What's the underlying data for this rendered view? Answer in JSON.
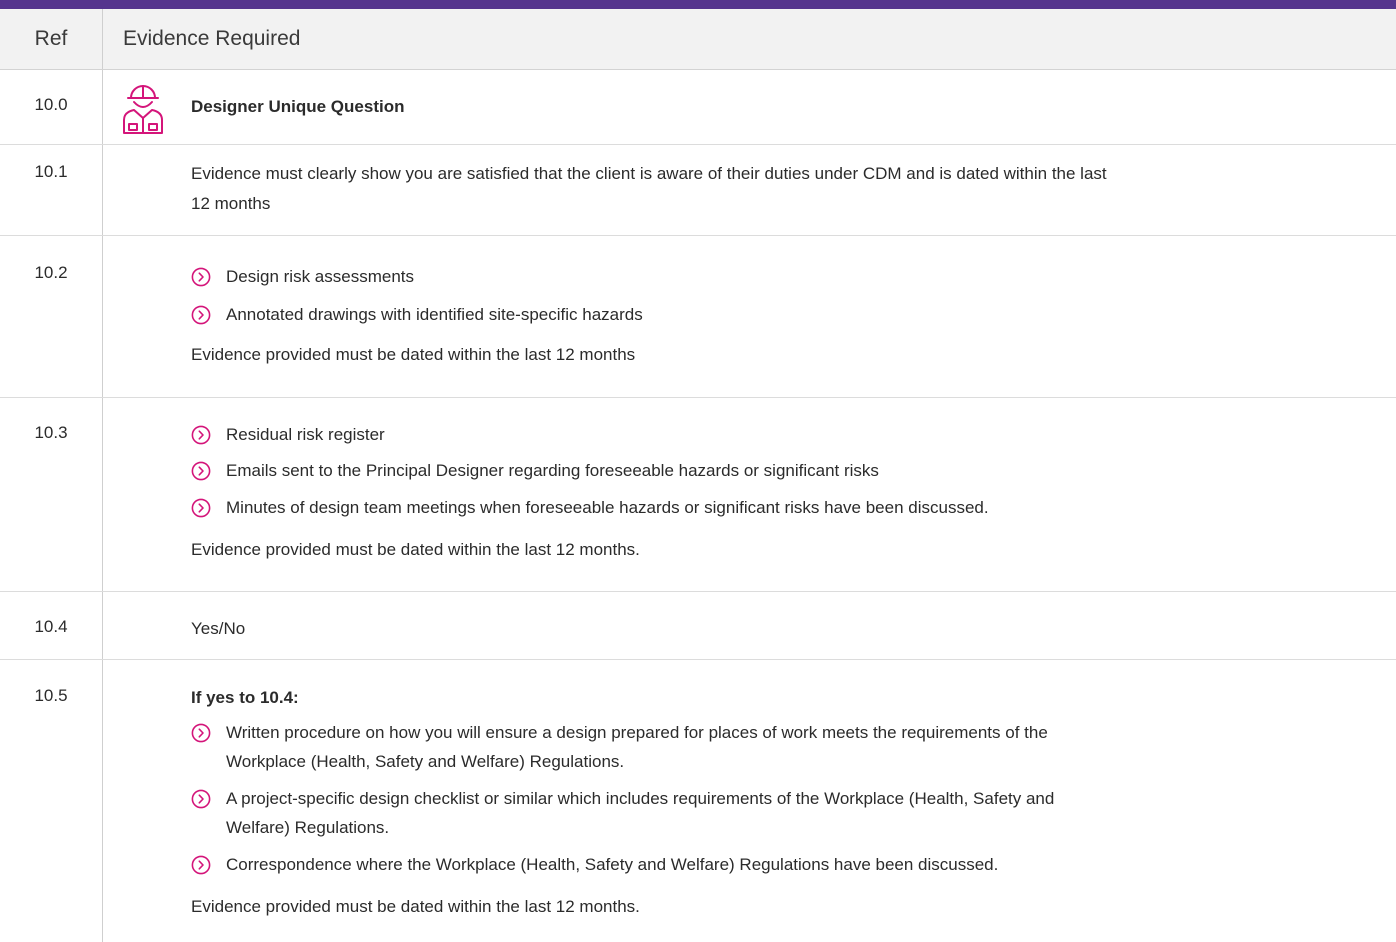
{
  "header": {
    "ref": "Ref",
    "evidence": "Evidence Required"
  },
  "colors": {
    "topbar": "#55348d",
    "accent": "#d4157a",
    "header_bg": "#f2f2f2"
  },
  "rows": [
    {
      "ref": "10.0",
      "icon": "construction-worker-icon",
      "title": "Designer Unique Question"
    },
    {
      "ref": "10.1",
      "text_line1": "Evidence must clearly show you are satisfied that the client is aware of their duties under CDM and is dated within the last",
      "text_line2": "12 months"
    },
    {
      "ref": "10.2",
      "bullets": [
        "Design risk assessments",
        "Annotated drawings with identified site-specific hazards"
      ],
      "footer": "Evidence provided must be dated within the last 12 months"
    },
    {
      "ref": "10.3",
      "bullets": [
        "Residual risk register",
        "Emails sent to the Principal Designer regarding foreseeable hazards or significant risks",
        "Minutes of design team meetings when foreseeable hazards or significant risks have been discussed."
      ],
      "footer": "Evidence provided must be dated within the last 12 months."
    },
    {
      "ref": "10.4",
      "text": "Yes/No"
    },
    {
      "ref": "10.5",
      "intro": "If yes to 10.4:",
      "bullets": [
        {
          "line1": "Written procedure on how you will ensure a design prepared for places of work meets the requirements of the",
          "line2": "Workplace (Health, Safety and Welfare) Regulations."
        },
        {
          "line1": "A project-specific design checklist or similar which includes requirements of the Workplace (Health, Safety and",
          "line2": "Welfare) Regulations."
        },
        {
          "line1": "Correspondence where the Workplace (Health, Safety and Welfare) Regulations have been discussed."
        }
      ],
      "footer": "Evidence provided must be dated within the last 12 months."
    }
  ]
}
